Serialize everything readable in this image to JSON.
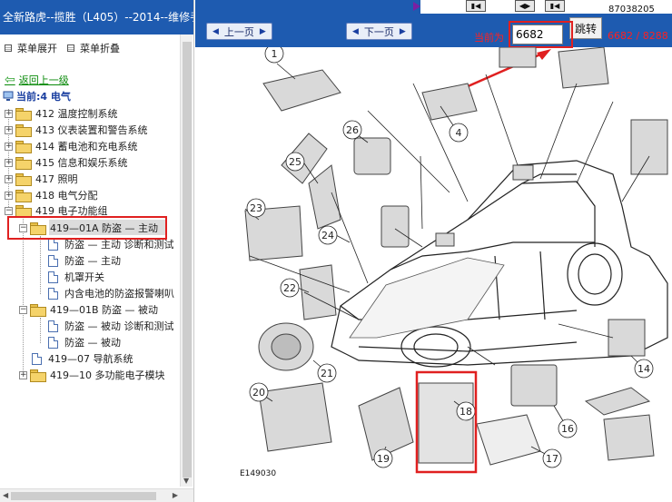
{
  "sidebar": {
    "title": "全新路虎--揽胜（L405）--2014--维修手",
    "expand_label": "菜单展开",
    "collapse_label": "菜单折叠",
    "back_label": "返回上一级",
    "current_label": "当前:4 电气",
    "tree": [
      {
        "id": "412",
        "label": "412 温度控制系统",
        "type": "folder",
        "expander": "+"
      },
      {
        "id": "413",
        "label": "413 仪表装置和警告系统",
        "type": "folder",
        "expander": "+"
      },
      {
        "id": "414",
        "label": "414 蓄电池和充电系统",
        "type": "folder",
        "expander": "+"
      },
      {
        "id": "415",
        "label": "415 信息和娱乐系统",
        "type": "folder",
        "expander": "+"
      },
      {
        "id": "417",
        "label": "417 照明",
        "type": "folder",
        "expander": "+"
      },
      {
        "id": "418",
        "label": "418 电气分配",
        "type": "folder",
        "expander": "+"
      },
      {
        "id": "419",
        "label": "419 电子功能组",
        "type": "folder",
        "expander": "−"
      },
      {
        "id": "419-01A",
        "label": "419—01A 防盗 — 主动",
        "type": "folder",
        "expander": "−",
        "selected": true
      },
      {
        "id": "doc1",
        "label": "防盗 — 主动 诊断和测试",
        "type": "doc"
      },
      {
        "id": "doc2",
        "label": "防盗 — 主动",
        "type": "doc"
      },
      {
        "id": "doc3",
        "label": "机罩开关",
        "type": "doc"
      },
      {
        "id": "doc4",
        "label": "内含电池的防盗报警喇叭",
        "type": "doc"
      },
      {
        "id": "419-01B",
        "label": "419—01B 防盗 — 被动",
        "type": "folder",
        "expander": "−"
      },
      {
        "id": "doc5",
        "label": "防盗 — 被动 诊断和测试",
        "type": "doc"
      },
      {
        "id": "doc6",
        "label": "防盗 — 被动",
        "type": "doc"
      },
      {
        "id": "419-07",
        "label": "419—07 导航系统",
        "type": "doc"
      },
      {
        "id": "419-10",
        "label": "419—10 多功能电子模块",
        "type": "folder",
        "expander": "+"
      }
    ]
  },
  "toolbar": {
    "prev_label": "上一页",
    "next_label": "下一页",
    "page_label": "当前为",
    "page_value": "6682",
    "jump_label": "跳转",
    "page_count": "6682 / 8288",
    "top_text": "87038205"
  },
  "diagram": {
    "figure_code": "E149030",
    "callouts": [
      "1",
      "4",
      "14",
      "16",
      "17",
      "18",
      "19",
      "20",
      "21",
      "22",
      "23",
      "24",
      "25",
      "26"
    ],
    "highlight_color": "#e02020",
    "header_color": "#1e5bb0"
  }
}
